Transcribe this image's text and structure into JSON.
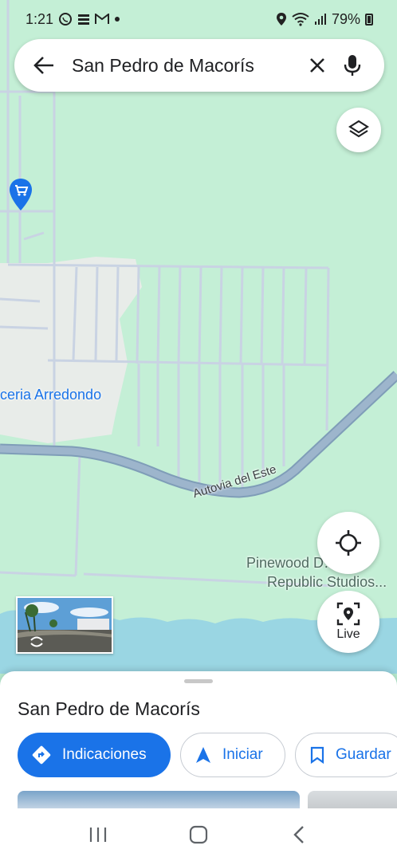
{
  "status_bar": {
    "time": "1:21",
    "battery": "79%",
    "left_icons": [
      "whatsapp-icon",
      "app-icon",
      "gmail-icon",
      "dot-icon"
    ],
    "right_icons": [
      "location-icon",
      "wifi-icon",
      "signal-icon",
      "battery-icon"
    ]
  },
  "search": {
    "query": "San Pedro de Macorís"
  },
  "map": {
    "labels": {
      "poi": "ceria Arredondo",
      "road": "Autovia del Este",
      "studio_line1": "Pinewood D…can",
      "studio_line2": "Republic Studios..."
    },
    "live_label": "Live",
    "colors": {
      "land": "#c4efd6",
      "urban": "#e8ece9",
      "road": "#8fa8bf",
      "water": "#9ad6e3",
      "accent": "#1a73e8"
    }
  },
  "place": {
    "title": "San Pedro de Macorís",
    "actions": {
      "directions": "Indicaciones",
      "start": "Iniciar",
      "save": "Guardar"
    }
  }
}
